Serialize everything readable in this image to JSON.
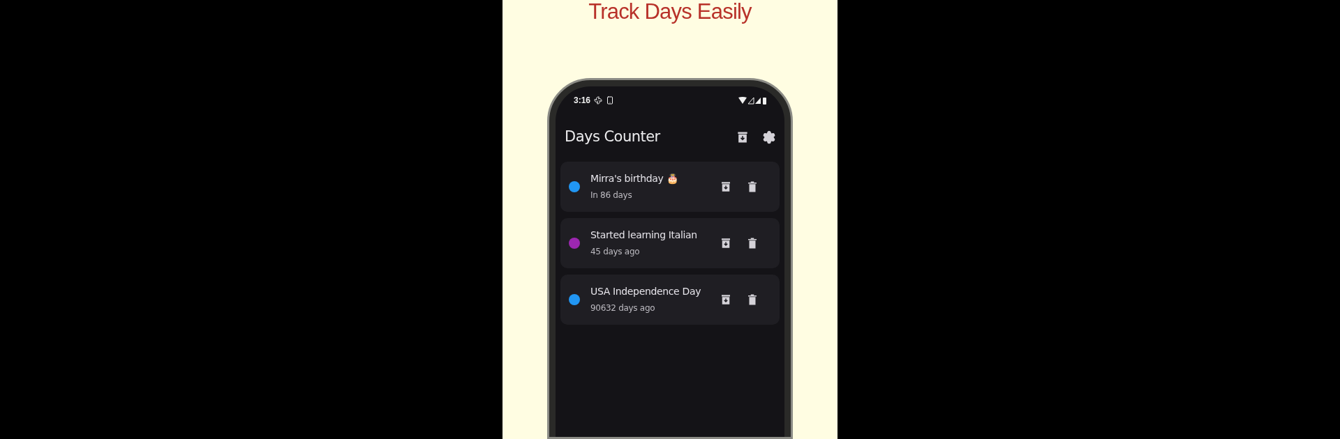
{
  "headline": "Track Days Easily",
  "status_bar": {
    "time": "3:16"
  },
  "app_bar": {
    "title": "Days Counter"
  },
  "events": [
    {
      "title": "Mirra's birthday 🎂",
      "subtitle": "In 86 days",
      "color": "#2196f3"
    },
    {
      "title": "Started learning Italian",
      "subtitle": "45 days ago",
      "color": "#9c27b0"
    },
    {
      "title": "USA Independence Day",
      "subtitle": "90632 days ago",
      "color": "#2196f3"
    }
  ]
}
